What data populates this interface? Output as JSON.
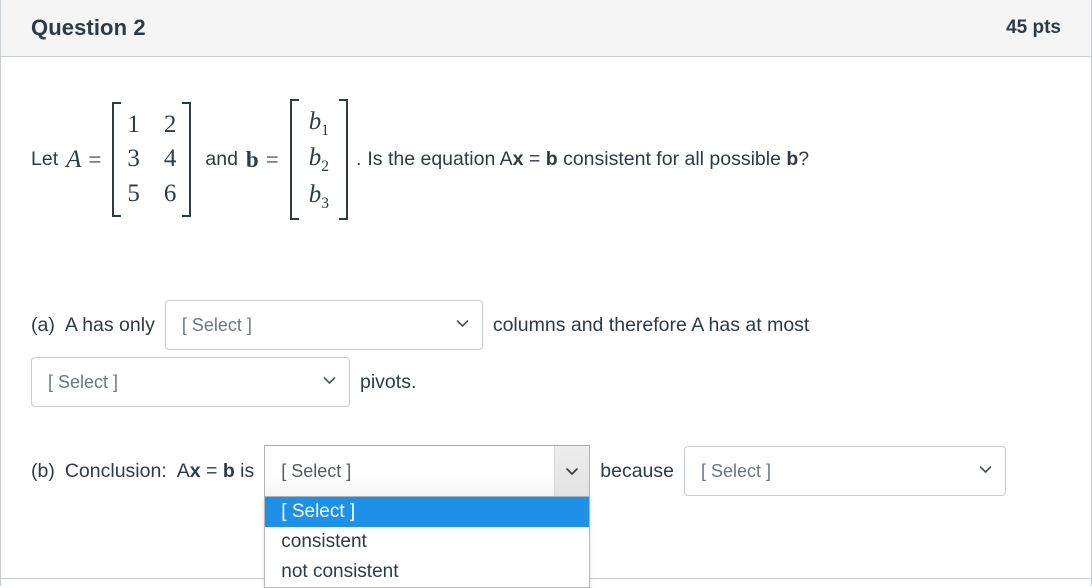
{
  "header": {
    "title": "Question 2",
    "points": "45 pts"
  },
  "prompt": {
    "let_label": "Let",
    "matrix_a_name": "A",
    "equals": "=",
    "matrix_a": [
      [
        "1",
        "2"
      ],
      [
        "3",
        "4"
      ],
      [
        "5",
        "6"
      ]
    ],
    "and_label": "and",
    "vector_b_name": "b",
    "vector_b": [
      "b",
      "b",
      "b"
    ],
    "vector_b_subs": [
      "1",
      "2",
      "3"
    ],
    "period": ".",
    "question_pre": "Is the equation A",
    "question_x": "x",
    "question_eq": " = ",
    "question_b": "b",
    "question_post": " consistent for all possible ",
    "question_b2": "b",
    "question_end": "?"
  },
  "part_a": {
    "marker": "(a)",
    "text_before": "A has only",
    "text_middle": "columns and therefore A has at most",
    "text_after": "pivots.",
    "select_columns_value": "[ Select ]",
    "select_pivots_value": "[ Select ]"
  },
  "part_b": {
    "marker": "(b)",
    "label": "Conclusion:",
    "eq_pre": "A",
    "eq_x": "x",
    "eq_mid": " = ",
    "eq_b": "b",
    "eq_post": " is",
    "select_conclusion_value": "[ Select ]",
    "because_label": "because",
    "select_reason_value": "[ Select ]",
    "dropdown_options": [
      {
        "label": "[ Select ]",
        "selected": true
      },
      {
        "label": "consistent",
        "selected": false
      },
      {
        "label": "not consistent",
        "selected": false
      }
    ]
  },
  "colors": {
    "highlight": "#1e90e8",
    "text": "#2d3b45",
    "border": "#c7cdd1",
    "header_bg": "#f5f5f5",
    "placeholder": "#6b7780"
  }
}
